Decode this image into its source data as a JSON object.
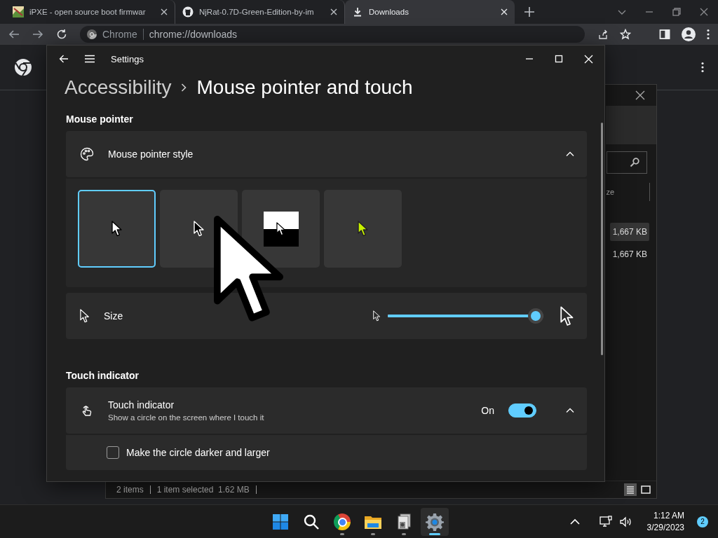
{
  "browser": {
    "tabs": [
      {
        "title": "iPXE - open source boot firmwar",
        "kind": "picture",
        "selected": false
      },
      {
        "title": "NjRat-0.7D-Green-Edition-by-im",
        "kind": "cat",
        "selected": false
      },
      {
        "title": "Downloads",
        "kind": "download",
        "selected": true
      }
    ],
    "address": {
      "site_label": "Chrome",
      "url": "chrome://downloads"
    }
  },
  "explorer": {
    "column_header": "ze",
    "rows": [
      {
        "size": "1,667 KB",
        "selected": true
      },
      {
        "size": "1,667 KB",
        "selected": false
      }
    ],
    "status": [
      "2 items",
      "1 item selected  1.62 MB"
    ]
  },
  "settings": {
    "title": "Settings",
    "breadcrumb": [
      "Accessibility",
      "Mouse pointer and touch"
    ],
    "sections": [
      {
        "heading": "Mouse pointer",
        "cards": [
          {
            "kind": "styles",
            "label": "Mouse pointer style",
            "expanded": true,
            "styles": [
              {
                "kind": "white",
                "selected": true
              },
              {
                "kind": "black",
                "selected": false
              },
              {
                "kind": "inverted",
                "selected": false
              },
              {
                "kind": "custom",
                "color": "#c6f000",
                "selected": false
              }
            ]
          },
          {
            "kind": "slider",
            "label": "Size",
            "level": 1.0
          }
        ]
      },
      {
        "heading": "Touch indicator",
        "cards": [
          {
            "kind": "toggle",
            "label": "Touch indicator",
            "description": "Show a circle on the screen where I touch it",
            "state_label": "On",
            "on": true,
            "expanded": true,
            "option": {
              "label": "Make the circle darker and larger",
              "checked": false
            }
          }
        ]
      }
    ]
  },
  "taskbar": {
    "apps": [
      {
        "kind": "start",
        "running": false,
        "selected": false
      },
      {
        "kind": "search",
        "running": false,
        "selected": false
      },
      {
        "kind": "browser",
        "running": true,
        "selected": false
      },
      {
        "kind": "folder",
        "running": true,
        "selected": false
      },
      {
        "kind": "files",
        "running": true,
        "selected": false
      },
      {
        "kind": "gear",
        "running": true,
        "selected": true
      }
    ],
    "time": "1:12 AM",
    "date": "3/29/2023",
    "notifications": "2"
  }
}
